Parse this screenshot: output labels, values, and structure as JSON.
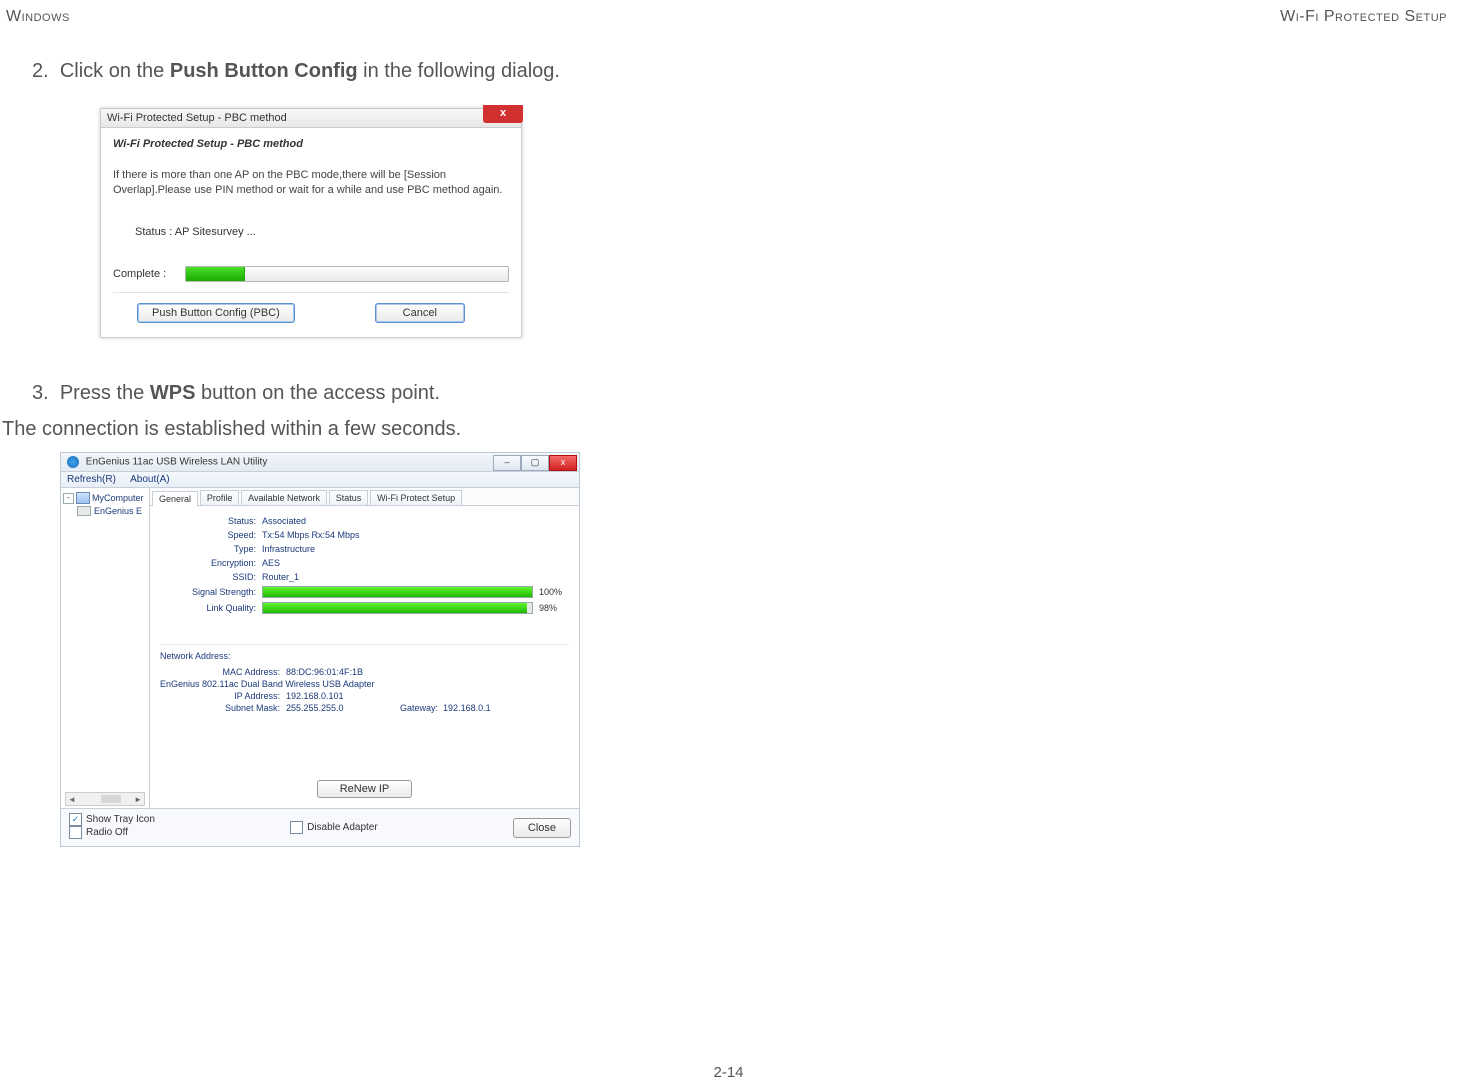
{
  "header": {
    "left": "Windows",
    "right": "Wi-Fi Protected Setup"
  },
  "step2": {
    "num": "2.",
    "pre": "Click on the ",
    "bold": "Push Button Config",
    "post": " in the following dialog."
  },
  "step3": {
    "num": "3.",
    "pre": "Press the ",
    "bold": "WPS",
    "post": " button on the access point."
  },
  "conn_line": "The connection is established within a few seconds.",
  "page_num": "2-14",
  "dlg1": {
    "title": "Wi-Fi Protected Setup - PBC method",
    "heading": "Wi-Fi Protected Setup - PBC method",
    "info": "If there is more than one AP on the PBC mode,there will be [Session Overlap].Please use PIN method or wait for a while and use PBC method again.",
    "status": "Status : AP Sitesurvey ...",
    "complete_label": "Complete :",
    "progress_pct": 18,
    "btn_pbc": "Push Button Config (PBC)",
    "btn_cancel": "Cancel",
    "close_x": "x"
  },
  "app": {
    "title": "EnGenius 11ac USB Wireless LAN Utility",
    "menu": {
      "refresh": "Refresh(R)",
      "about": "About(A)"
    },
    "tree": {
      "root": "MyComputer",
      "child": "EnGenius E"
    },
    "tabs": [
      "General",
      "Profile",
      "Available Network",
      "Status",
      "Wi-Fi Protect Setup"
    ],
    "general": {
      "status_k": "Status:",
      "status_v": "Associated",
      "speed_k": "Speed:",
      "speed_v": "Tx:54 Mbps Rx:54 Mbps",
      "type_k": "Type:",
      "type_v": "Infrastructure",
      "enc_k": "Encryption:",
      "enc_v": "AES",
      "ssid_k": "SSID:",
      "ssid_v": "Router_1",
      "sig_k": "Signal Strength:",
      "sig_pct": "100%",
      "sig_fill": 100,
      "lq_k": "Link Quality:",
      "lq_pct": "98%",
      "lq_fill": 98,
      "net_title": "Network Address:",
      "mac_k": "MAC Address:",
      "mac_v": "88:DC:96:01:4F:1B",
      "adapter": "EnGenius 802.11ac Dual Band Wireless USB Adapter",
      "ip_k": "IP Address:",
      "ip_v": "192.168.0.101",
      "mask_k": "Subnet Mask:",
      "mask_v": "255.255.255.0",
      "gw_k": "Gateway:",
      "gw_v": "192.168.0.1",
      "renew": "ReNew IP"
    },
    "bottom": {
      "tray": "Show Tray Icon",
      "radio": "Radio Off",
      "disable": "Disable Adapter",
      "close": "Close"
    }
  }
}
